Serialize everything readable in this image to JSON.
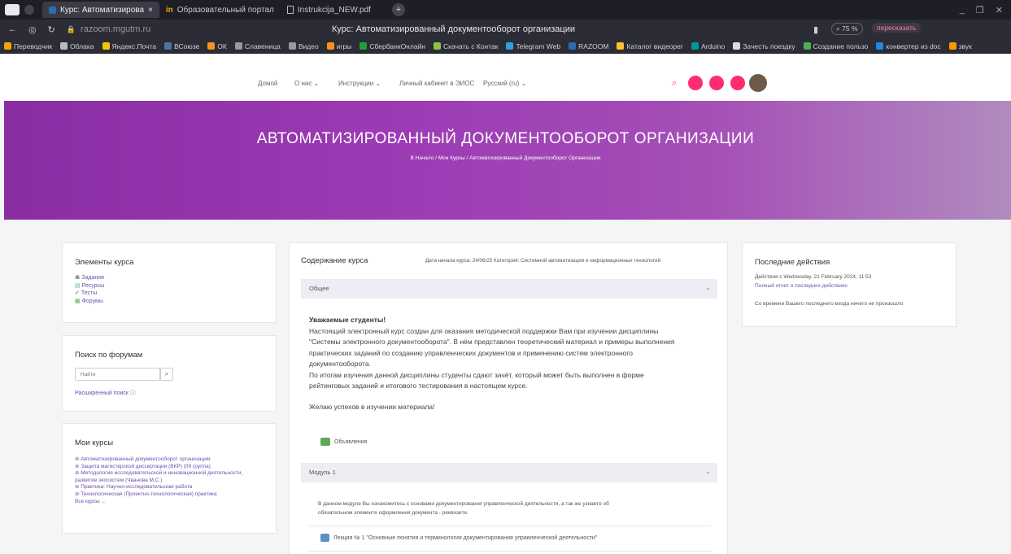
{
  "browser": {
    "tabs": [
      {
        "label": "Курс: Автоматизирова",
        "close": "×"
      },
      {
        "label": "Образовательный портал"
      },
      {
        "label": "Instrukcija_NEW.pdf"
      }
    ],
    "new_tab": "+",
    "address": "razoom.mgutm.ru",
    "page_title": "Курс: Автоматизированный документооборот организации",
    "zoom": "75 %",
    "retell": "пересказать"
  },
  "bookmarks": [
    {
      "label": "Переводчик",
      "color": "#f4a300"
    },
    {
      "label": "Облака",
      "color": "#bbb"
    },
    {
      "label": "Яндекс.Почта",
      "color": "#f4c400"
    },
    {
      "label": "ВСоюзе",
      "color": "#4a76a8"
    },
    {
      "label": "ОК",
      "color": "#f7931e"
    },
    {
      "label": "Славеница",
      "color": "#999"
    },
    {
      "label": "Видео",
      "color": "#999"
    },
    {
      "label": "игры",
      "color": "#f7931e"
    },
    {
      "label": "СбербанкОнлайн",
      "color": "#21a038"
    },
    {
      "label": "Скачать с Контак",
      "color": "#8bc34a"
    },
    {
      "label": "Telegram Web",
      "color": "#2aa3df"
    },
    {
      "label": "RAZOOM",
      "color": "#2b6cb0"
    },
    {
      "label": "Каталог видеорег",
      "color": "#fbc02d"
    },
    {
      "label": "Arduino",
      "color": "#00979d"
    },
    {
      "label": "Зачесть поездку",
      "color": "#ddd"
    },
    {
      "label": "Создание пользо",
      "color": "#4caf50"
    },
    {
      "label": "конвертер из doc",
      "color": "#1e88e5"
    },
    {
      "label": "звук",
      "color": "#ff9800"
    }
  ],
  "nav": {
    "home": "Домой",
    "about": "О нас",
    "instructions": "Инструкции",
    "cabinet": "Личный кабинет в ЭИОС",
    "language": "Русский (ru)"
  },
  "hero": {
    "title": "АВТОМАТИЗИРОВАННЫЙ ДОКУМЕНТООБОРОТ ОРГАНИЗАЦИИ",
    "breadcrumb": "В Начало  /  Мои Курсы  /  Автоматизированный Документооборот Организации"
  },
  "course_elements": {
    "title": "Элементы курса",
    "items": [
      "Задания",
      "Ресурсы",
      "Тесты",
      "Форумы"
    ]
  },
  "forum_search": {
    "title": "Поиск по форумам",
    "placeholder": "Найти",
    "advanced": "Расширенный поиск"
  },
  "my_courses": {
    "title": "Мои курсы",
    "items": [
      "Автоматизированный документооборот организации",
      "Защита магистерской диссертации (ВКР) (09 группа)",
      "Методология исследовательской и инновационной деятельности, развитие экосистем (Чванова М.С.)",
      "Практика: Научно-исследовательская работа",
      "Технологическая (Проектно-технологическая) практика"
    ],
    "all": "Все курсы ..."
  },
  "content": {
    "title": "Содержание курса",
    "meta": "Дата начала курса: 24/06/25  Категория: Системной автоматизации и информационных технологий",
    "section1": "Общее",
    "greeting": "Уважаемые студенты!",
    "paragraph": [
      "Настоящий электронный курс создан для оказания методической поддержки Вам при изучении дисциплины",
      "\"Системы электронного документооборота\". В нём представлен теоретический материал и примеры выполнения",
      "практических заданий по созданию управленческих документов и применению систем электронного",
      "документооборота.",
      "По итогам изучения данной дисциплины студенты сдают зачёт, который может быть выполнен в форме",
      "рейтинговых заданий и итогового тестирования в настоящем курсе."
    ],
    "wish": "Желаю успехов в изучении материала!",
    "announcements": "Объявления",
    "section2": "Модуль 1",
    "module_desc": [
      "В данном модуле Вы ознакомитесь с основами документирования управленческой деятельности, а так же узнаете об",
      "обязательном элементе оформления документа - реквизите."
    ],
    "lecture": "Лекция № 1 \"Основные понятия и терминология документирования управленческой деятельности\""
  },
  "recent": {
    "title": "Последние действия",
    "since": "Действия с Wednesday, 21 February 2024, 11:53",
    "full_report": "Полный отчет о последних действиях",
    "nothing": "Со времени Вашего последнего входа ничего не произошло"
  }
}
